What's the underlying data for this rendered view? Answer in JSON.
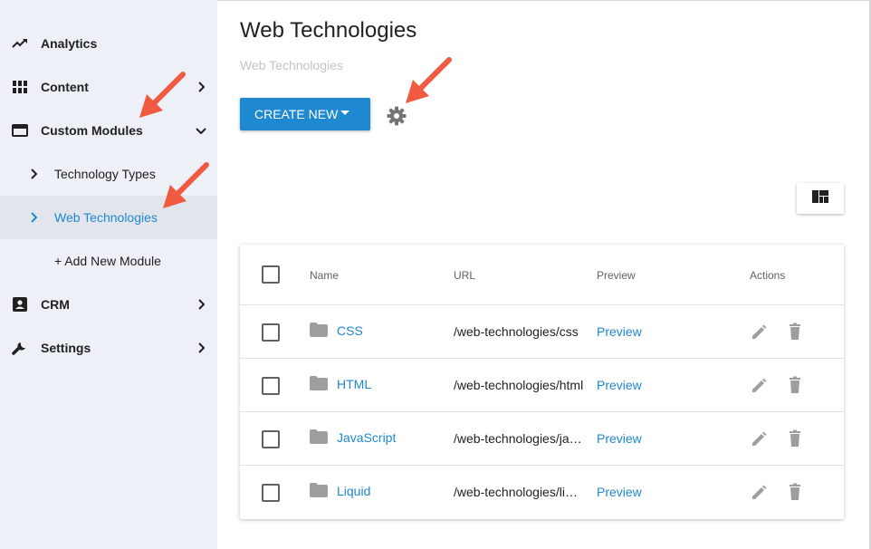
{
  "sidebar": {
    "items": [
      {
        "label": "Analytics",
        "icon": "trending-up-icon"
      },
      {
        "label": "Content",
        "icon": "grid-icon"
      },
      {
        "label": "Custom Modules",
        "icon": "web-asset-icon"
      },
      {
        "label": "CRM",
        "icon": "contact-card-icon"
      },
      {
        "label": "Settings",
        "icon": "wrench-icon"
      }
    ],
    "sub_items": [
      {
        "label": "Technology Types"
      },
      {
        "label": "Web Technologies"
      },
      {
        "label": "+ Add New Module"
      }
    ]
  },
  "main": {
    "title": "Web Technologies",
    "subtitle": "Web Technologies",
    "create_label": "CREATE NEW"
  },
  "table": {
    "columns": [
      "Name",
      "URL",
      "Preview",
      "Actions"
    ],
    "rows": [
      {
        "name": "CSS",
        "url": "/web-technologies/css",
        "preview": "Preview"
      },
      {
        "name": "HTML",
        "url": "/web-technologies/html",
        "preview": "Preview"
      },
      {
        "name": "JavaScript",
        "url": "/web-technologies/javascript",
        "preview": "Preview"
      },
      {
        "name": "Liquid",
        "url": "/web-technologies/liquid",
        "preview": "Preview"
      }
    ]
  },
  "colors": {
    "accent": "#1e88d0",
    "sidebar_bg": "#eef0f7",
    "annotation_arrow": "#f05a40"
  }
}
